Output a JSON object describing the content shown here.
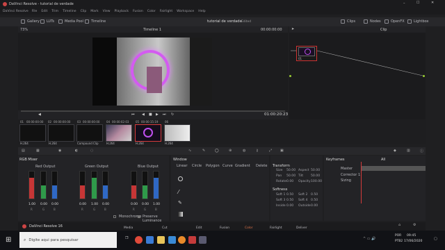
{
  "window": {
    "title": "DaVinci Resolve - tutorial de verdade"
  },
  "menu": [
    "DaVinci Resolve",
    "File",
    "Edit",
    "Trim",
    "Timeline",
    "Clip",
    "Mark",
    "View",
    "Playback",
    "Fusion",
    "Color",
    "Fairlight",
    "Workspace",
    "Help"
  ],
  "toolbar": {
    "left": [
      "Gallery",
      "LUTs",
      "Media Pool",
      "Timeline"
    ],
    "project": "tutorial de verdade",
    "edited": "Edited",
    "right": [
      "Clips",
      "Nodes",
      "OpenFX",
      "Lightbox"
    ]
  },
  "viewer": {
    "zoom": "73%",
    "timeline_name": "Timeline 1",
    "timecode_top": "00:00:00:00",
    "clip_label": "Clip",
    "timecode": "01:00:20:23"
  },
  "clips": [
    {
      "num": "01",
      "tc": "00:00:00:00",
      "codec": "H.264",
      "thumb": "#0d0d0d"
    },
    {
      "num": "02",
      "tc": "00:00:00:00",
      "codec": "H.264",
      "thumb": "#0d0d0d"
    },
    {
      "num": "03",
      "tc": "00:00:00:00",
      "codec": "Compound Clip",
      "thumb": "#050505"
    },
    {
      "num": "04",
      "tc": "00:00:02:03",
      "codec": "H.264",
      "thumb": "#5a3b53"
    },
    {
      "num": "05",
      "tc": "00:00:15:19",
      "codec": "H.264",
      "thumb": "#140d1c"
    },
    {
      "num": "06",
      "tc": "",
      "codec": "H.264",
      "thumb": "#c9c9c9"
    }
  ],
  "rgb_mixer": {
    "title": "RGB Mixer",
    "outputs": [
      {
        "label": "Red Output",
        "values": [
          "1.00",
          "0.00",
          "0.00"
        ],
        "letters": [
          "R",
          "G",
          "B"
        ]
      },
      {
        "label": "Green Output",
        "values": [
          "0.00",
          "1.00",
          "0.00"
        ],
        "letters": [
          "R",
          "G",
          "B"
        ]
      },
      {
        "label": "Blue Output",
        "values": [
          "0.00",
          "0.00",
          "1.00"
        ],
        "letters": [
          "R",
          "G",
          "B"
        ]
      }
    ],
    "monochrome": "Monochrome",
    "preserve": "Preserve Luminance"
  },
  "window_panel": {
    "title": "Window",
    "shapes": [
      "Linear",
      "Circle",
      "Polygon",
      "Curve",
      "Gradient"
    ],
    "delete": "Delete"
  },
  "transform": {
    "title": "Transform",
    "rows": [
      [
        "Size",
        "Aspect"
      ],
      [
        "Pan",
        "Tilt"
      ],
      [
        "Rotate",
        "Opacity"
      ]
    ],
    "values": [
      [
        "50.00",
        "50.00"
      ],
      [
        "50.00",
        "50.00"
      ],
      [
        "0.00",
        "100.00"
      ]
    ]
  },
  "softness": {
    "title": "Softness",
    "rows": [
      [
        "Soft 1",
        "Soft 2"
      ],
      [
        "Soft 3",
        "Soft 4"
      ],
      [
        "Inside",
        "Outside"
      ]
    ],
    "values": [
      [
        "0.50",
        "0.50"
      ],
      [
        "0.50",
        "0.50"
      ],
      [
        "0.00",
        "0.00"
      ]
    ]
  },
  "keyframes": {
    "title": "Keyframes",
    "filter": "All",
    "rows": [
      "Master",
      "Corrector 1",
      "Sizing"
    ]
  },
  "node": {
    "label": "01"
  },
  "pages": [
    "Media",
    "Cut",
    "Edit",
    "Fusion",
    "Color",
    "Fairlight",
    "Deliver"
  ],
  "active_page": "Color",
  "app_name": "DaVinci Resolve 16",
  "taskbar": {
    "search_placeholder": "Digite aqui para pesquisar",
    "lang": "POR",
    "lang2": "PTB2",
    "time": "09:45",
    "date": "17/06/2020"
  },
  "colors": {
    "accent_red": "#d63b3b",
    "active_page": "#e0744a"
  }
}
